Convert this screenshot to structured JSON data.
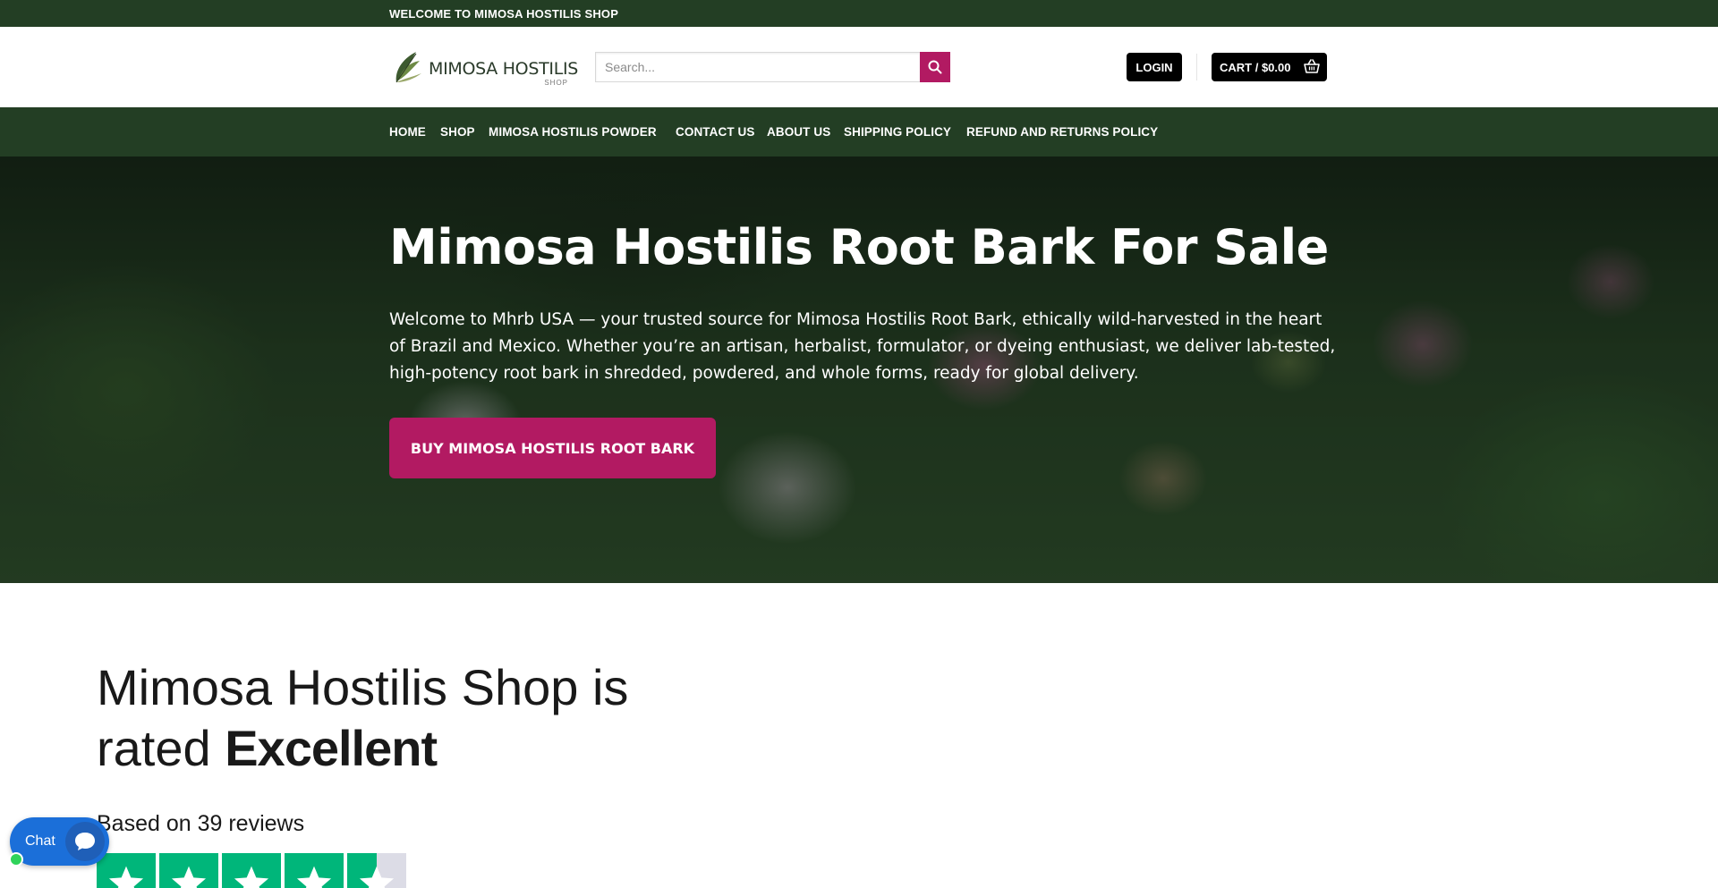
{
  "topbar": {
    "text": "WELCOME TO MIMOSA HOSTILIS SHOP"
  },
  "header": {
    "logo": {
      "title": "MIMOSA HOSTILIS",
      "subtitle": "SHOP"
    },
    "search": {
      "placeholder": "Search...",
      "value": ""
    },
    "login_label": "LOGIN",
    "cart_label": "CART / $0.00"
  },
  "nav": {
    "items": [
      {
        "label": "HOME"
      },
      {
        "label": "SHOP"
      },
      {
        "label": "MIMOSA HOSTILIS POWDER"
      },
      {
        "label": "CONTACT US"
      },
      {
        "label": "ABOUT US"
      },
      {
        "label": "SHIPPING POLICY"
      },
      {
        "label": "REFUND AND RETURNS POLICY"
      }
    ]
  },
  "hero": {
    "title": "Mimosa Hostilis Root Bark For Sale",
    "text": "Welcome to Mhrb USA — your trusted source for Mimosa Hostilis Root Bark, ethically wild-harvested in the heart of Brazil and Mexico. Whether you’re an artisan, herbalist, formulator, or dyeing enthusiast, we deliver lab-tested, high-potency root bark in shredded, powdered, and whole forms, ready for global delivery.",
    "cta_label": "BUY MIMOSA HOSTILIS ROOT BARK"
  },
  "rating": {
    "title_prefix": "Mimosa Hostilis Shop is rated ",
    "rating_word": "Excellent",
    "reviews_text": "Based on 39 reviews",
    "stars_filled": 4.5,
    "stars_total": 5
  },
  "chat": {
    "label": "Chat"
  },
  "colors": {
    "brand_green": "#233e24",
    "accent": "#b21a62",
    "star_green": "#00b67a",
    "chat_blue": "#1b6fd9"
  }
}
